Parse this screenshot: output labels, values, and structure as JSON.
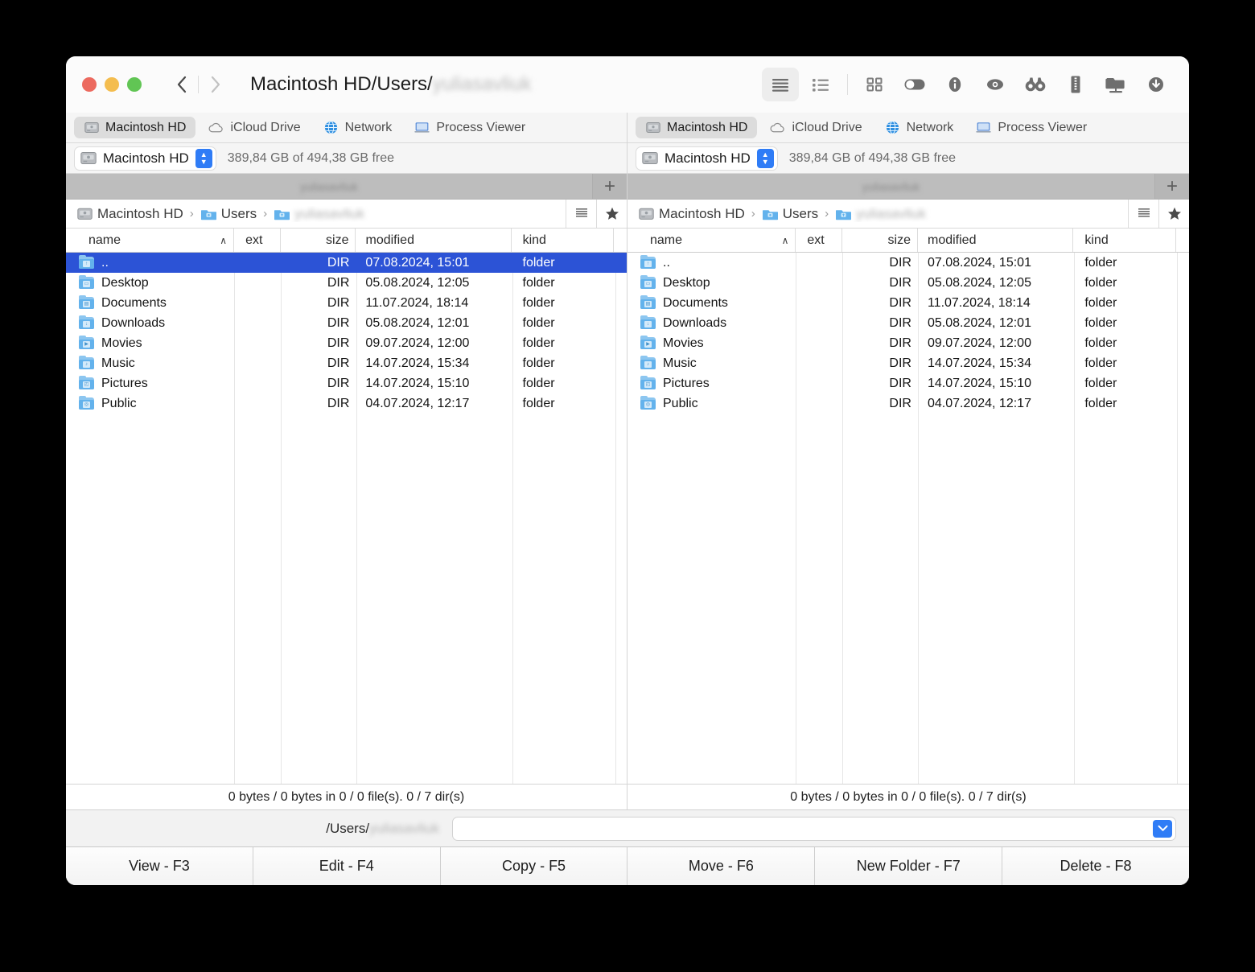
{
  "window": {
    "title_visible": "Macintosh HD/Users/",
    "title_blurred": "yuliasavliuk",
    "traffic_lights": [
      "close",
      "minimize",
      "maximize"
    ],
    "back_label": "‹",
    "forward_label": "›"
  },
  "toolbar": {
    "items": [
      {
        "name": "brief-view",
        "icon": "lines-icon",
        "active": true
      },
      {
        "name": "detailed-view",
        "icon": "list-detail-icon",
        "active": false
      },
      {
        "name": "grid-view",
        "icon": "grid-icon",
        "active": false
      },
      {
        "name": "toggle-panels",
        "icon": "toggle-switch-icon",
        "active": false
      },
      {
        "name": "info",
        "icon": "info-circle-icon",
        "active": false
      },
      {
        "name": "quick-look",
        "icon": "eye-icon",
        "active": false
      },
      {
        "name": "search",
        "icon": "binoculars-icon",
        "active": false
      },
      {
        "name": "archive",
        "icon": "zip-icon",
        "active": false
      },
      {
        "name": "network-folder",
        "icon": "network-folder-icon",
        "active": false
      },
      {
        "name": "download",
        "icon": "download-circle-icon",
        "active": false
      }
    ]
  },
  "accent_color": "#2f7cf6",
  "selection_color": "#2c53d6",
  "panels": [
    {
      "id": "left",
      "tabs": [
        {
          "label": "Macintosh HD",
          "icon": "hard-drive-icon",
          "active": true
        },
        {
          "label": "iCloud Drive",
          "icon": "cloud-icon",
          "active": false
        },
        {
          "label": "Network",
          "icon": "globe-icon",
          "active": false
        },
        {
          "label": "Process Viewer",
          "icon": "monitor-icon",
          "active": false
        }
      ],
      "drive": {
        "name": "Macintosh HD",
        "free": "389,84 GB of 494,38 GB free"
      },
      "folder_tab": {
        "label_blurred": "yuliasavliuk",
        "add_label": "+"
      },
      "breadcrumb": [
        {
          "label": "Macintosh HD",
          "icon": "hard-drive-icon",
          "blurred": false
        },
        {
          "label": "Users",
          "icon": "folder-icon",
          "blurred": false
        },
        {
          "label": "yuliasavliuk",
          "icon": "folder-icon",
          "blurred": true
        }
      ],
      "columns": [
        {
          "key": "name",
          "label": "name",
          "sorted": true,
          "sort_arrow": "∧"
        },
        {
          "key": "ext",
          "label": "ext"
        },
        {
          "key": "size",
          "label": "size"
        },
        {
          "key": "modified",
          "label": "modified"
        },
        {
          "key": "kind",
          "label": "kind"
        }
      ],
      "rows": [
        {
          "name": "..",
          "ext": "",
          "size": "DIR",
          "modified": "07.08.2024, 15:01",
          "kind": "folder",
          "selected": true,
          "badge": "↑"
        },
        {
          "name": "Desktop",
          "ext": "",
          "size": "DIR",
          "modified": "05.08.2024, 12:05",
          "kind": "folder",
          "selected": false,
          "badge": "▭"
        },
        {
          "name": "Documents",
          "ext": "",
          "size": "DIR",
          "modified": "11.07.2024, 18:14",
          "kind": "folder",
          "selected": false,
          "badge": "▤"
        },
        {
          "name": "Downloads",
          "ext": "",
          "size": "DIR",
          "modified": "05.08.2024, 12:01",
          "kind": "folder",
          "selected": false,
          "badge": "↓"
        },
        {
          "name": "Movies",
          "ext": "",
          "size": "DIR",
          "modified": "09.07.2024, 12:00",
          "kind": "folder",
          "selected": false,
          "badge": "▶"
        },
        {
          "name": "Music",
          "ext": "",
          "size": "DIR",
          "modified": "14.07.2024, 15:34",
          "kind": "folder",
          "selected": false,
          "badge": "♪"
        },
        {
          "name": "Pictures",
          "ext": "",
          "size": "DIR",
          "modified": "14.07.2024, 15:10",
          "kind": "folder",
          "selected": false,
          "badge": "◰"
        },
        {
          "name": "Public",
          "ext": "",
          "size": "DIR",
          "modified": "04.07.2024, 12:17",
          "kind": "folder",
          "selected": false,
          "badge": "◎"
        }
      ],
      "status": "0 bytes / 0 bytes in 0 / 0 file(s). 0 / 7 dir(s)"
    },
    {
      "id": "right",
      "tabs": [
        {
          "label": "Macintosh HD",
          "icon": "hard-drive-icon",
          "active": true
        },
        {
          "label": "iCloud Drive",
          "icon": "cloud-icon",
          "active": false
        },
        {
          "label": "Network",
          "icon": "globe-icon",
          "active": false
        },
        {
          "label": "Process Viewer",
          "icon": "monitor-icon",
          "active": false
        }
      ],
      "drive": {
        "name": "Macintosh HD",
        "free": "389,84 GB of 494,38 GB free"
      },
      "folder_tab": {
        "label_blurred": "yuliasavliuk",
        "add_label": "+"
      },
      "breadcrumb": [
        {
          "label": "Macintosh HD",
          "icon": "hard-drive-icon",
          "blurred": false
        },
        {
          "label": "Users",
          "icon": "folder-icon",
          "blurred": false
        },
        {
          "label": "yuliasavliuk",
          "icon": "folder-icon",
          "blurred": true
        }
      ],
      "columns": [
        {
          "key": "name",
          "label": "name",
          "sorted": true,
          "sort_arrow": "∧"
        },
        {
          "key": "ext",
          "label": "ext"
        },
        {
          "key": "size",
          "label": "size"
        },
        {
          "key": "modified",
          "label": "modified"
        },
        {
          "key": "kind",
          "label": "kind"
        }
      ],
      "rows": [
        {
          "name": "..",
          "ext": "",
          "size": "DIR",
          "modified": "07.08.2024, 15:01",
          "kind": "folder",
          "selected": false,
          "badge": "↑"
        },
        {
          "name": "Desktop",
          "ext": "",
          "size": "DIR",
          "modified": "05.08.2024, 12:05",
          "kind": "folder",
          "selected": false,
          "badge": "▭"
        },
        {
          "name": "Documents",
          "ext": "",
          "size": "DIR",
          "modified": "11.07.2024, 18:14",
          "kind": "folder",
          "selected": false,
          "badge": "▤"
        },
        {
          "name": "Downloads",
          "ext": "",
          "size": "DIR",
          "modified": "05.08.2024, 12:01",
          "kind": "folder",
          "selected": false,
          "badge": "↓"
        },
        {
          "name": "Movies",
          "ext": "",
          "size": "DIR",
          "modified": "09.07.2024, 12:00",
          "kind": "folder",
          "selected": false,
          "badge": "▶"
        },
        {
          "name": "Music",
          "ext": "",
          "size": "DIR",
          "modified": "14.07.2024, 15:34",
          "kind": "folder",
          "selected": false,
          "badge": "♪"
        },
        {
          "name": "Pictures",
          "ext": "",
          "size": "DIR",
          "modified": "14.07.2024, 15:10",
          "kind": "folder",
          "selected": false,
          "badge": "◰"
        },
        {
          "name": "Public",
          "ext": "",
          "size": "DIR",
          "modified": "04.07.2024, 12:17",
          "kind": "folder",
          "selected": false,
          "badge": "◎"
        }
      ],
      "status": "0 bytes / 0 bytes in 0 / 0 file(s). 0 / 7 dir(s)"
    }
  ],
  "command_line": {
    "path_visible": "/Users/",
    "path_blurred": "yuliasavliuk",
    "input_value": "",
    "input_placeholder": "",
    "dropdown_icon": "chevron-down-icon"
  },
  "function_bar": [
    {
      "label": "View - F3"
    },
    {
      "label": "Edit - F4"
    },
    {
      "label": "Copy - F5"
    },
    {
      "label": "Move - F6"
    },
    {
      "label": "New Folder - F7"
    },
    {
      "label": "Delete - F8"
    }
  ]
}
